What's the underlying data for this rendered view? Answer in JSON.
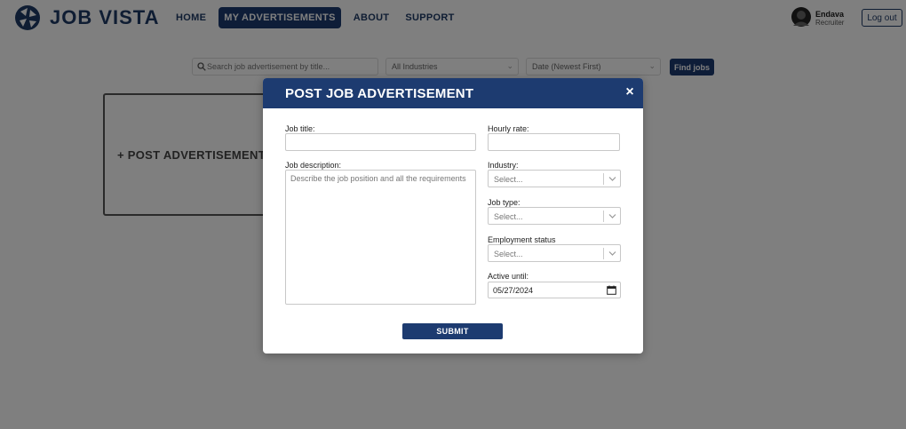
{
  "brand": {
    "name": "JOB VISTA",
    "color": "#1d3b70"
  },
  "nav": {
    "items": [
      {
        "label": "HOME",
        "active": false
      },
      {
        "label": "MY ADVERTISEMENTS",
        "active": true
      },
      {
        "label": "ABOUT",
        "active": false
      },
      {
        "label": "SUPPORT",
        "active": false
      }
    ]
  },
  "user": {
    "name": "Endava",
    "role": "Recruiter",
    "logout_label": "Log out"
  },
  "search": {
    "placeholder": "Search job advertisement by title...",
    "industry_value": "All Industries",
    "sort_value": "Date (Newest First)",
    "find_label": "Find jobs",
    "search_icon": "search-icon"
  },
  "post_card": {
    "label": "+ POST ADVERTISEMENT"
  },
  "modal": {
    "title": "POST JOB ADVERTISEMENT",
    "close_label": "×",
    "job_title": {
      "label": "Job title:",
      "value": ""
    },
    "job_description": {
      "label": "Job description:",
      "placeholder": "Describe the job position and all the requirements"
    },
    "hourly_rate": {
      "label": "Hourly rate:",
      "value": ""
    },
    "industry": {
      "label": "Industry:",
      "value": "Select..."
    },
    "job_type": {
      "label": "Job type:",
      "value": "Select..."
    },
    "employment_status": {
      "label": "Employment status",
      "value": "Select..."
    },
    "active_until": {
      "label": "Active until:",
      "value": "05/27/2024"
    },
    "submit_label": "SUBMIT"
  }
}
